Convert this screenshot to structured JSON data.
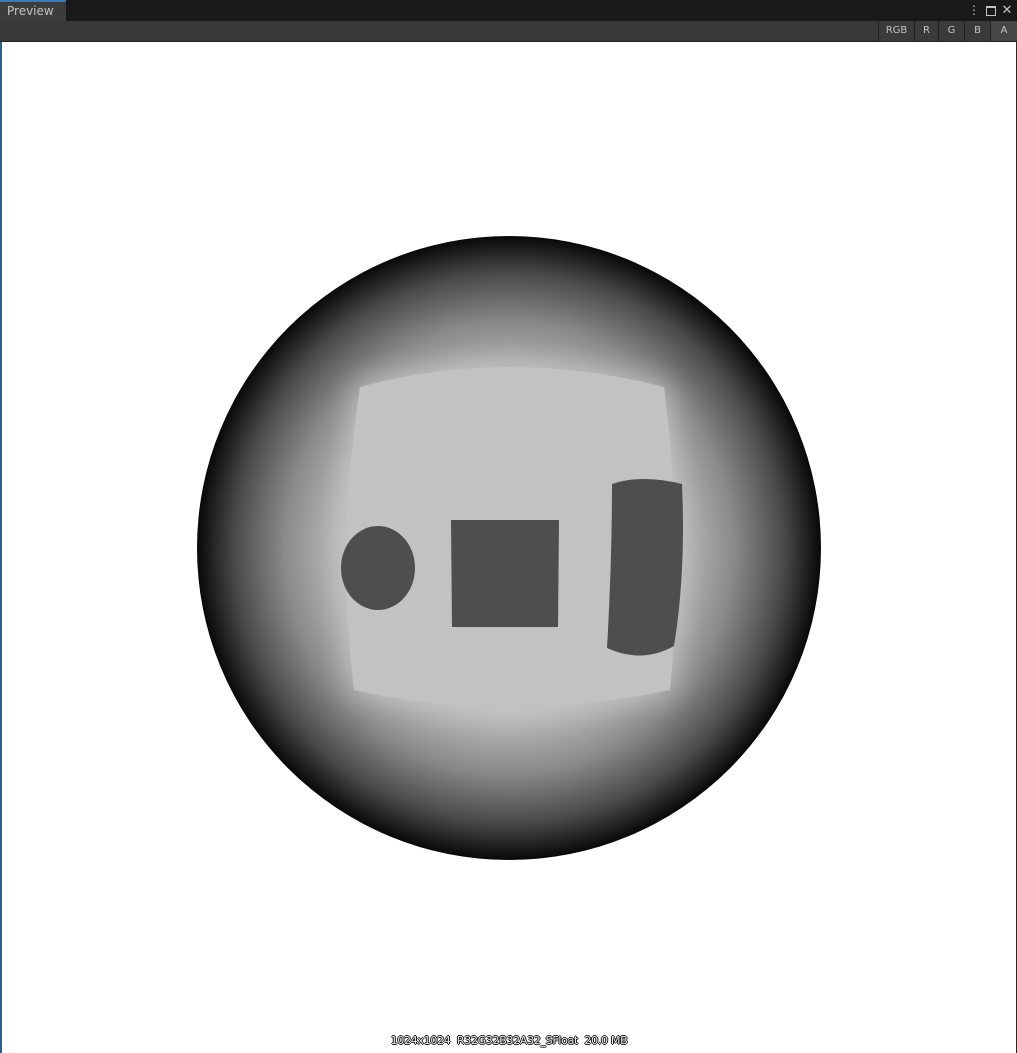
{
  "window": {
    "tab_title": "Preview",
    "menu_icon": "⋮",
    "close_icon": "✕"
  },
  "toolbar": {
    "channels": [
      "RGB",
      "R",
      "G",
      "B",
      "A"
    ],
    "active_channel": "A"
  },
  "preview": {
    "info_text": "1024x1024  R32G32B32A32_SFloat  20.0 MB",
    "colors": {
      "background": "#ffffff",
      "sphere_center": "#c2c2c2",
      "sphere_edge": "#080808",
      "shapes": "#4e4e4e"
    }
  }
}
